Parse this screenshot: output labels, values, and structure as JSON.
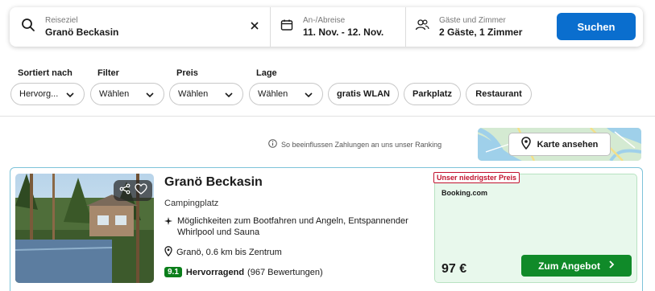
{
  "search": {
    "destination_label": "Reiseziel",
    "destination_value": "Granö Beckasin",
    "dates_label": "An-/Abreise",
    "dates_value": "11. Nov. - 12. Nov.",
    "guests_label": "Gäste und Zimmer",
    "guests_value": "2 Gäste, 1 Zimmer",
    "search_button": "Suchen"
  },
  "filters": {
    "sort": {
      "label": "Sortiert nach",
      "value": "Hervorg..."
    },
    "filter": {
      "label": "Filter",
      "value": "Wählen"
    },
    "price": {
      "label": "Preis",
      "value": "Wählen"
    },
    "location": {
      "label": "Lage",
      "value": "Wählen"
    },
    "chips": [
      "gratis WLAN",
      "Parkplatz",
      "Restaurant"
    ]
  },
  "ranking_info": "So beeinflussen Zahlungen an uns unser Ranking",
  "map": {
    "button_label": "Karte ansehen"
  },
  "result": {
    "name": "Granö Beckasin",
    "type": "Campingplatz",
    "feature": "Möglichkeiten zum Bootfahren und Angeln, Entspannender Whirlpool und Sauna",
    "location": "Granö, 0.6 km bis Zentrum",
    "rating_score": "9.1",
    "rating_word": "Hervorragend",
    "rating_count": "(967 Bewertungen)",
    "offer": {
      "badge": "Unser niedrigster Preis",
      "provider": "Booking.com",
      "price": "97 €",
      "button": "Zum Angebot"
    }
  },
  "colors": {
    "primary": "#0a6ece",
    "deal_green": "#108a29",
    "rating_green": "#0a7e1a",
    "badge_red": "#c1122e",
    "offer_bg": "#e8f8ec"
  },
  "icons": {
    "destination": "search-icon",
    "clear": "close-icon",
    "dates": "calendar-icon",
    "guests": "users-icon",
    "select": "chevron-down-icon",
    "info": "info-icon",
    "map": "map-pin-icon",
    "share": "share-icon",
    "favorite": "heart-icon",
    "feature": "sparkle-icon",
    "location": "location-pin-icon",
    "deal": "chevron-right-icon"
  }
}
